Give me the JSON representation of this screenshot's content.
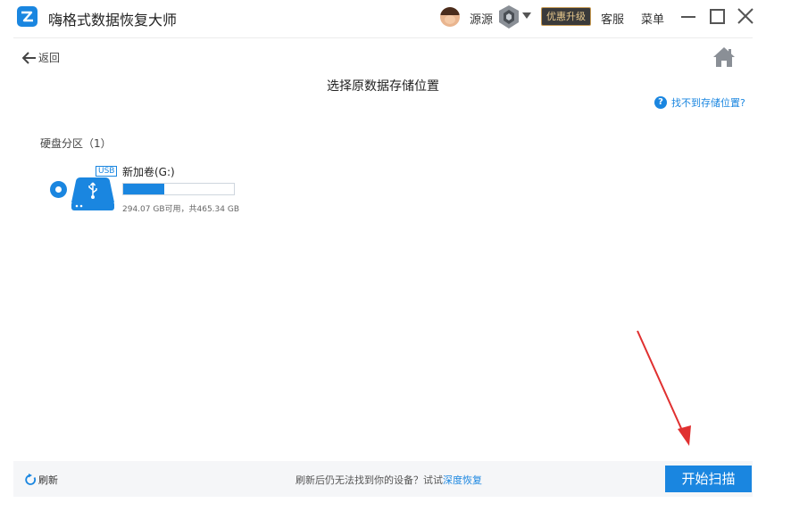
{
  "app": {
    "title": "嗨格式数据恢复大师"
  },
  "user": {
    "name": "源源",
    "promo_label": "优惠升级"
  },
  "topbar": {
    "service_label": "客服",
    "menu_label": "菜单"
  },
  "nav": {
    "back_label": "返回"
  },
  "page": {
    "title": "选择原数据存储位置",
    "help_link": "找不到存储位置?"
  },
  "partitions": {
    "section_label": "硬盘分区（1）",
    "items": [
      {
        "tag": "USB",
        "name": "新加卷(G:)",
        "used_fraction": 0.37,
        "capacity_text": "294.07 GB可用，共465.34 GB",
        "selected": true
      }
    ]
  },
  "footer": {
    "refresh_label": "刷新",
    "message": "刷新后仍无法找到你的设备？试试",
    "deep_recovery_link": "深度恢复",
    "scan_button": "开始扫描"
  },
  "colors": {
    "accent": "#1a86e0",
    "annotation_arrow": "#e03030",
    "promo_text": "#e8c98d"
  },
  "icons": [
    "app-logo-icon",
    "avatar",
    "rank-badge-icon",
    "chevron-down-icon",
    "minimize-icon",
    "maximize-icon",
    "close-icon",
    "back-arrow-icon",
    "home-icon",
    "help-icon",
    "usb-drive-icon",
    "refresh-icon"
  ]
}
